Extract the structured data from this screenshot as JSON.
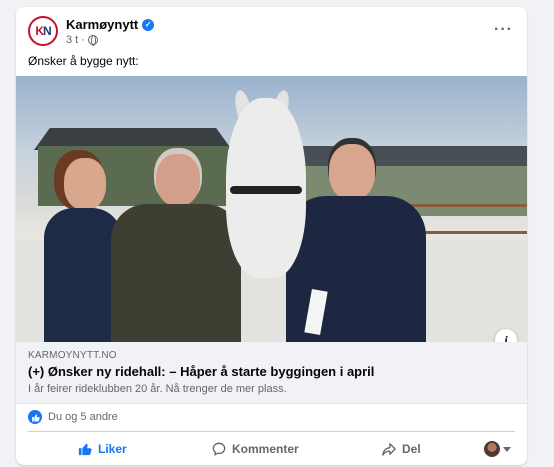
{
  "post": {
    "page_name": "Karmøynytt",
    "avatar_text_k": "K",
    "avatar_text_n": "N",
    "time": "3 t",
    "separator": "·",
    "text": "Ønsker å bygge nytt:",
    "more_label": "···"
  },
  "link": {
    "domain": "KARMOYNYTT.NO",
    "headline": "(+) Ønsker ny ridehall: – Håper å starte byggingen i april",
    "description": "I år feirer rideklubben 20 år. Nå trenger de mer plass.",
    "info_label": "i"
  },
  "reactions": {
    "text": "Du og 5 andre"
  },
  "actions": {
    "like": "Liker",
    "comment": "Kommenter",
    "share": "Del"
  },
  "colors": {
    "accent": "#1877f2",
    "secondary_text": "#65676b",
    "brand_red": "#c8102e"
  },
  "icons": {
    "verified": "verified-badge-icon",
    "privacy": "globe-icon",
    "like": "thumbs-up-icon",
    "comment": "comment-bubble-icon",
    "share": "share-arrow-icon"
  }
}
